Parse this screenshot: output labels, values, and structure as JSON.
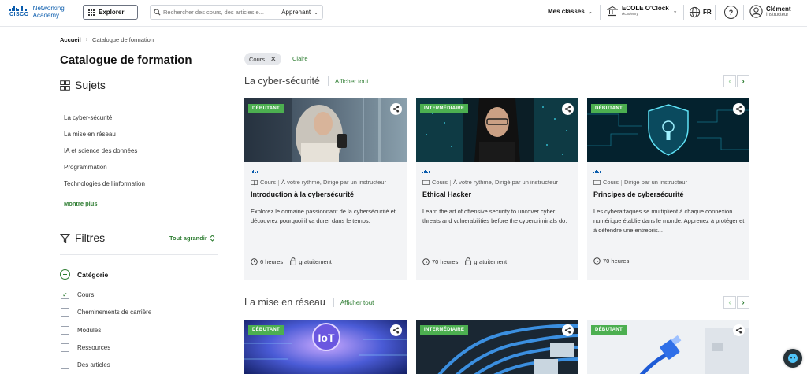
{
  "brand": {
    "cisco": "CISCO",
    "line1": "Networking",
    "line2": "Academy"
  },
  "header": {
    "explorer_label": "Explorer",
    "search_placeholder": "Rechercher des cours, des articles e...",
    "search_role": "Apprenant",
    "classes_label": "Mes classes",
    "school_name": "ECOLE O'Clock",
    "school_sub": "Academy",
    "lang": "FR",
    "user_name": "Clément",
    "user_role": "Instructeur"
  },
  "breadcrumb": {
    "home": "Accueil",
    "current": "Catalogue de formation"
  },
  "sidebar": {
    "title": "Catalogue de formation",
    "subjects_heading": "Sujets",
    "subjects": [
      "La cyber-sécurité",
      "La mise en réseau",
      "IA et science des données",
      "Programmation",
      "Technologies de l'information"
    ],
    "show_more": "Montre plus",
    "filters_heading": "Filtres",
    "expand_all": "Tout agrandir",
    "category_heading": "Catégorie",
    "categories": [
      {
        "label": "Cours",
        "checked": true
      },
      {
        "label": "Cheminements de carrière",
        "checked": false
      },
      {
        "label": "Modules",
        "checked": false
      },
      {
        "label": "Ressources",
        "checked": false
      },
      {
        "label": "Des articles",
        "checked": false
      }
    ]
  },
  "active_filter": {
    "chip": "Cours",
    "clear": "Claire"
  },
  "sections": [
    {
      "title": "La cyber-sécurité",
      "show_all": "Afficher tout",
      "cards": [
        {
          "badge": "DÉBUTANT",
          "type": "Cours",
          "mode": "À votre rythme, Dirigé par un instructeur",
          "title": "Introduction à la cybersécurité",
          "desc": "Explorez le domaine passionnant de la cybersécurité et découvrez pourquoi il va durer dans le temps.",
          "duration": "6 heures",
          "price": "gratuitement"
        },
        {
          "badge": "INTERMÉDIAIRE",
          "type": "Cours",
          "mode": "À votre rythme, Dirigé par un instructeur",
          "title": "Ethical Hacker",
          "desc": "Learn the art of offensive security to uncover cyber threats and vulnerabilities before the cybercriminals do.",
          "duration": "70 heures",
          "price": "gratuitement"
        },
        {
          "badge": "DÉBUTANT",
          "type": "Cours",
          "mode": "Dirigé par un instructeur",
          "title": "Principes de cybersécurité",
          "desc": "Les cyberattaques se multiplient à chaque connexion numérique établie dans le monde. Apprenez à protéger et à défendre une entrepris...",
          "duration": "70 heures",
          "price": ""
        }
      ]
    },
    {
      "title": "La mise en réseau",
      "show_all": "Afficher tout",
      "cards": [
        {
          "badge": "DÉBUTANT"
        },
        {
          "badge": "INTERMÉDIAIRE"
        },
        {
          "badge": "DÉBUTANT"
        }
      ]
    }
  ],
  "colors": {
    "accent": "#2e7d32",
    "badge": "#4caf50",
    "brand_blue": "#0a5cad"
  }
}
